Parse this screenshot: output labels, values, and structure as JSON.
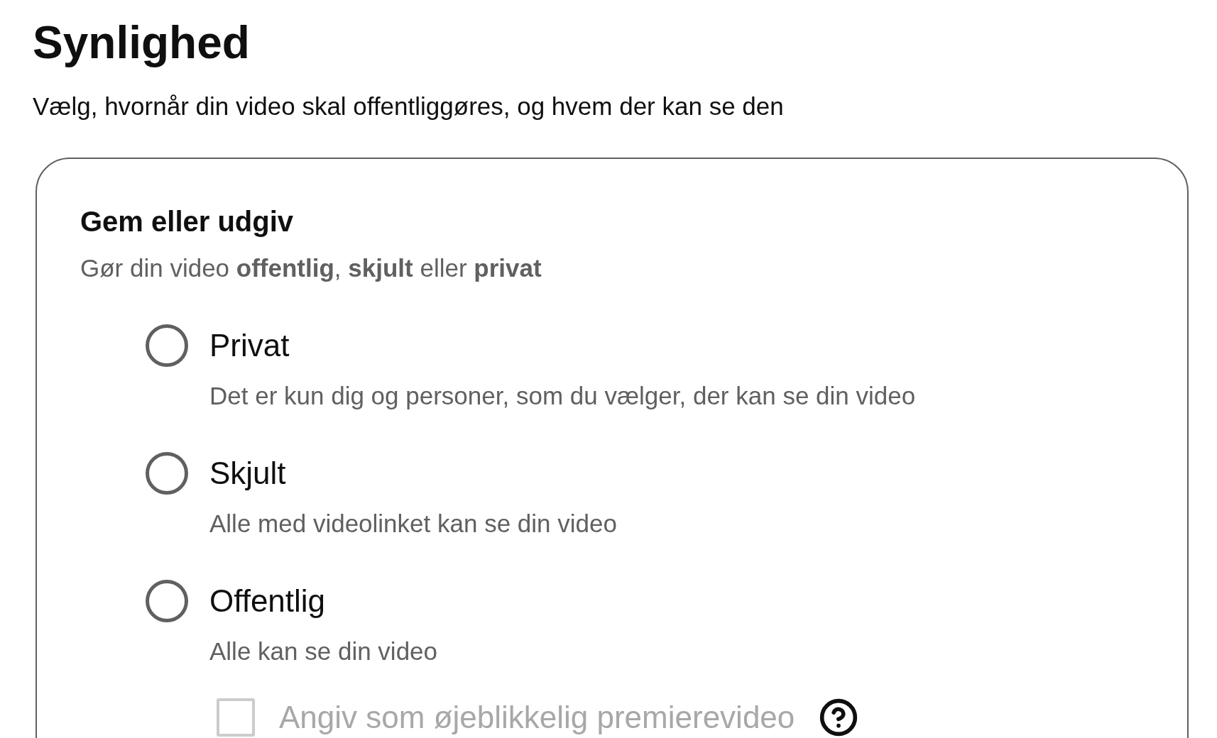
{
  "section": {
    "title": "Synlighed",
    "subtitle": "Vælg, hvornår din video skal offentliggøres, og hvem der kan se den"
  },
  "card": {
    "title": "Gem eller udgiv",
    "subtitle": "Gør din video **offentlig**, **skjult** eller **privat**",
    "options": [
      {
        "label": "Privat",
        "description": "Det er kun dig og personer, som du vælger, der kan se din video",
        "selected": false
      },
      {
        "label": "Skjult",
        "description": "Alle med videolinket kan se din video",
        "selected": false
      },
      {
        "label": "Offentlig",
        "description": "Alle kan se din video",
        "selected": false
      }
    ],
    "premiere": {
      "label": "Angiv som øjeblikkelig premierevideo",
      "checked": false,
      "disabled": true
    }
  }
}
